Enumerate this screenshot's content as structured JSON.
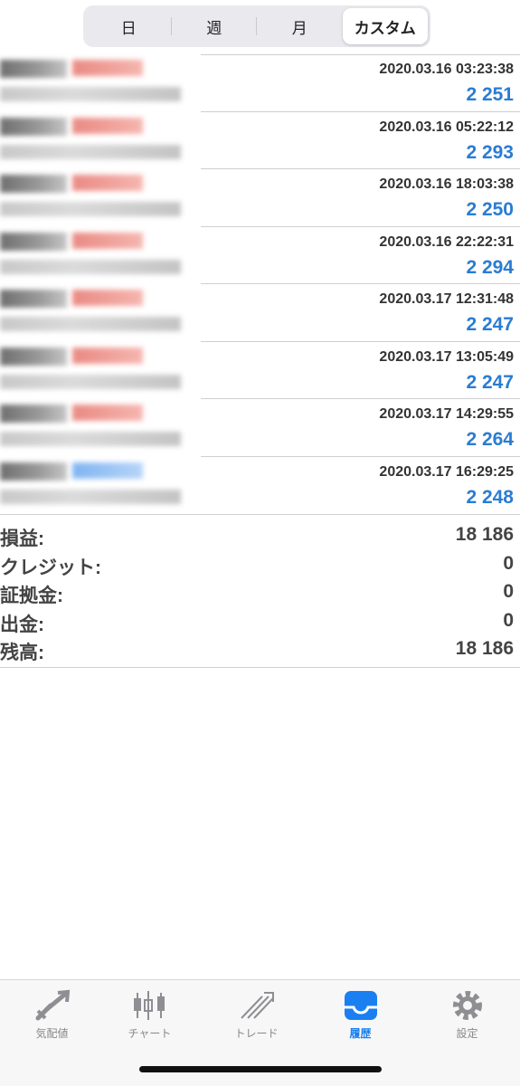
{
  "segments": [
    {
      "label": "日",
      "active": false
    },
    {
      "label": "週",
      "active": false
    },
    {
      "label": "月",
      "active": false
    },
    {
      "label": "カスタム",
      "active": true
    }
  ],
  "deals": [
    {
      "time": "2020.03.16 03:23:38",
      "profit": "2 251",
      "side_color": "red"
    },
    {
      "time": "2020.03.16 05:22:12",
      "profit": "2 293",
      "side_color": "red"
    },
    {
      "time": "2020.03.16 18:03:38",
      "profit": "2 250",
      "side_color": "red"
    },
    {
      "time": "2020.03.16 22:22:31",
      "profit": "2 294",
      "side_color": "red"
    },
    {
      "time": "2020.03.17 12:31:48",
      "profit": "2 247",
      "side_color": "red"
    },
    {
      "time": "2020.03.17 13:05:49",
      "profit": "2 247",
      "side_color": "red"
    },
    {
      "time": "2020.03.17 14:29:55",
      "profit": "2 264",
      "side_color": "red"
    },
    {
      "time": "2020.03.17 16:29:25",
      "profit": "2 248",
      "side_color": "blue"
    }
  ],
  "summary": [
    {
      "label": "損益:",
      "value": "18 186"
    },
    {
      "label": "クレジット:",
      "value": "0"
    },
    {
      "label": "証拠金:",
      "value": "0"
    },
    {
      "label": "出金:",
      "value": "0"
    },
    {
      "label": "残高:",
      "value": "18 186"
    }
  ],
  "tabs": [
    {
      "label": "気配値",
      "icon": "quotes-icon",
      "active": false
    },
    {
      "label": "チャート",
      "icon": "chart-icon",
      "active": false
    },
    {
      "label": "トレード",
      "icon": "trade-icon",
      "active": false
    },
    {
      "label": "履歴",
      "icon": "history-icon",
      "active": true
    },
    {
      "label": "設定",
      "icon": "settings-icon",
      "active": false
    }
  ],
  "colors": {
    "accent": "#1a7ff0",
    "profit": "#2a7cd2",
    "sell_marker": "#e6766e",
    "buy_marker": "#6aa7f0"
  }
}
